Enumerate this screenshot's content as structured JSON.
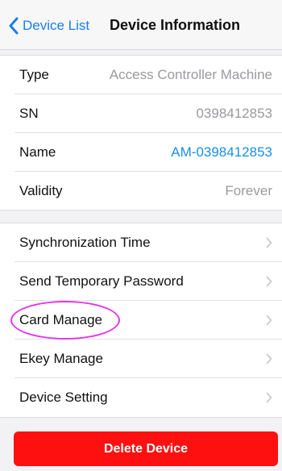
{
  "nav": {
    "back_label": "Device List",
    "title": "Device Information"
  },
  "info": [
    {
      "label": "Type",
      "value": "Access Controller Machine"
    },
    {
      "label": "SN",
      "value": "0398412853"
    },
    {
      "label": "Name",
      "value": "AM-0398412853"
    },
    {
      "label": "Validity",
      "value": "Forever"
    }
  ],
  "actions": [
    {
      "label": "Synchronization Time"
    },
    {
      "label": "Send Temporary Password"
    },
    {
      "label": "Card Manage"
    },
    {
      "label": "Ekey Manage"
    },
    {
      "label": "Device Setting"
    }
  ],
  "delete_label": "Delete Device",
  "colors": {
    "accent": "#1a7fe6",
    "link_value": "#1a8fe6",
    "danger": "#ff1010",
    "highlight_circle": "#e236e6"
  },
  "icons": {
    "back": "chevron-left-icon",
    "row": "chevron-right-icon"
  }
}
